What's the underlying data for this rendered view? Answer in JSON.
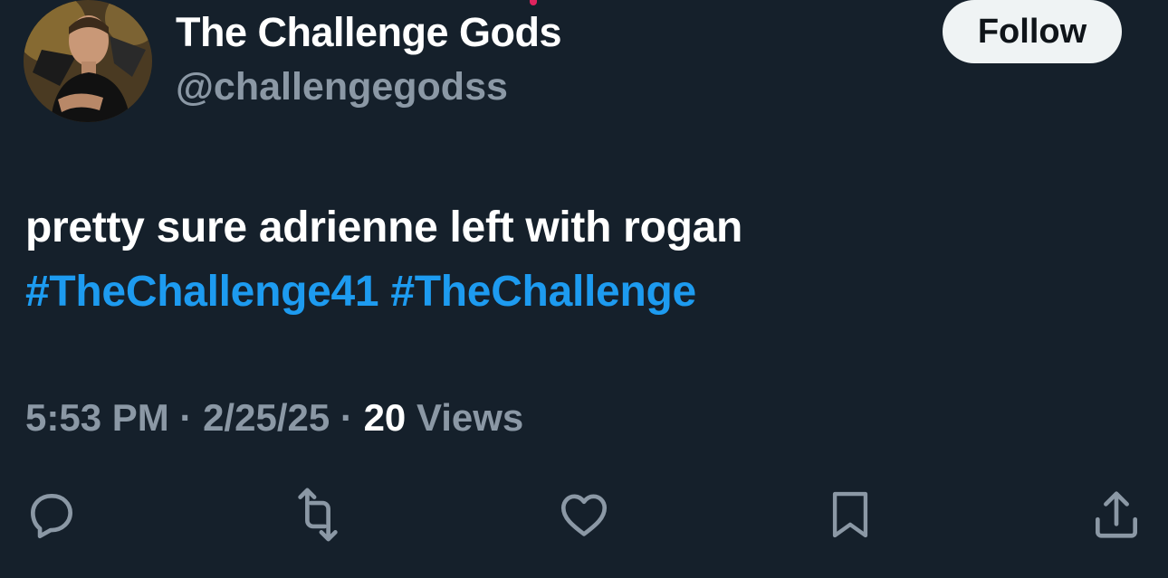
{
  "author": {
    "display_name": "The Challenge Gods",
    "handle": "@challengegodss"
  },
  "follow_button": {
    "label": "Follow"
  },
  "tweet": {
    "text": "pretty sure adrienne left with rogan",
    "hashtags": [
      "#TheChallenge41",
      "#TheChallenge"
    ]
  },
  "meta": {
    "time": "5:53 PM",
    "separator": "·",
    "date": "2/25/25",
    "views_count": "20",
    "views_label": "Views"
  },
  "actions": {
    "reply": "reply-icon",
    "retweet": "retweet-icon",
    "like": "heart-icon",
    "bookmark": "bookmark-icon",
    "share": "share-icon"
  },
  "colors": {
    "background": "#15202b",
    "primary_text": "#ffffff",
    "secondary_text": "#8b98a5",
    "link": "#1d9bf0",
    "follow_bg": "#eff3f4"
  }
}
